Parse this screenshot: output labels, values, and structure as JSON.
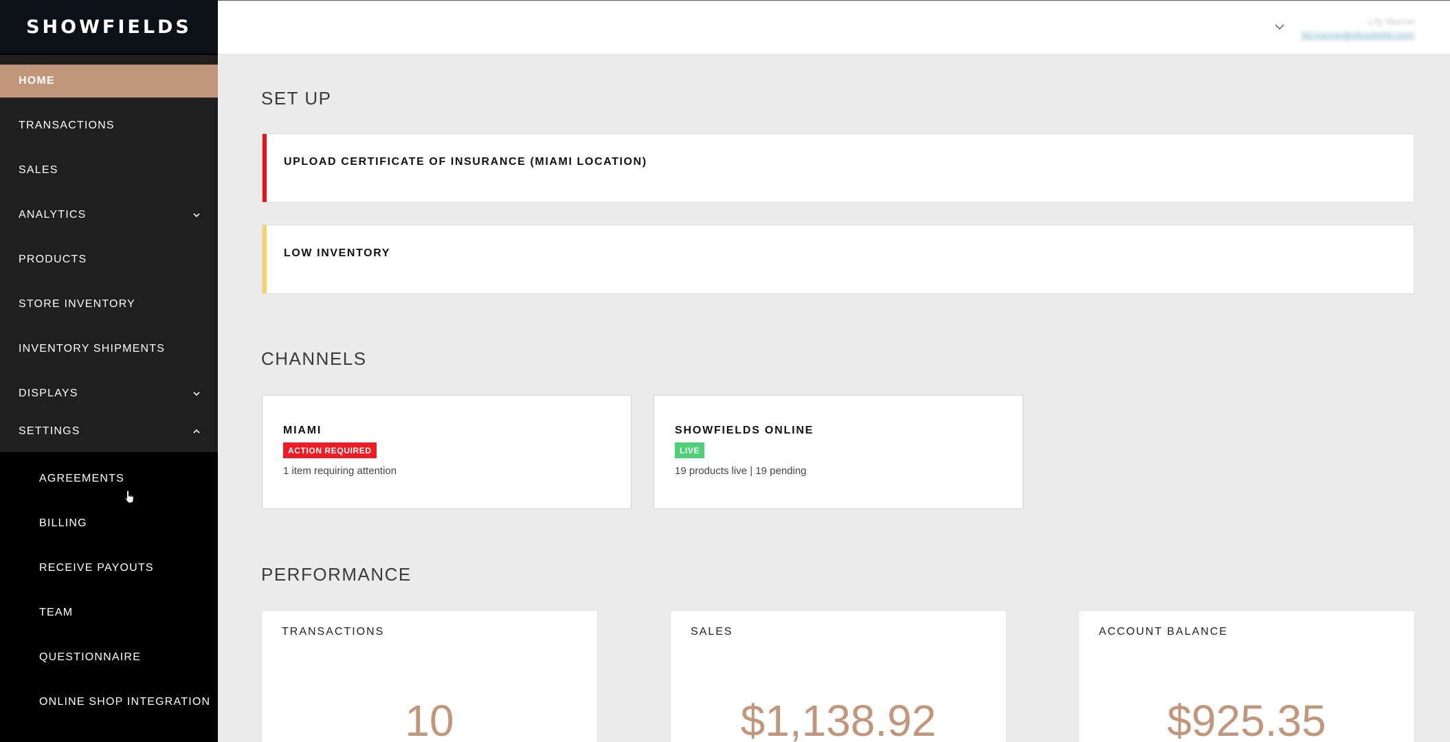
{
  "brand": {
    "logo_text": "SHOWFIELDS",
    "accent_color": "#c2967a"
  },
  "sidebar": {
    "items": [
      {
        "label": "HOME",
        "active": true
      },
      {
        "label": "TRANSACTIONS"
      },
      {
        "label": "SALES"
      },
      {
        "label": "ANALYTICS",
        "expandable": true,
        "expanded": false
      },
      {
        "label": "PRODUCTS"
      },
      {
        "label": "STORE INVENTORY"
      },
      {
        "label": "INVENTORY SHIPMENTS"
      },
      {
        "label": "DISPLAYS",
        "expandable": true,
        "expanded": false
      },
      {
        "label": "SETTINGS",
        "expandable": true,
        "expanded": true
      }
    ],
    "settings_submenu": [
      {
        "label": "AGREEMENTS"
      },
      {
        "label": "BILLING"
      },
      {
        "label": "RECEIVE PAYOUTS"
      },
      {
        "label": "TEAM"
      },
      {
        "label": "QUESTIONNAIRE"
      },
      {
        "label": "ONLINE SHOP INTEGRATION"
      }
    ]
  },
  "topbar": {
    "user_name": "Lily Mercer",
    "user_email": "lily.mercer@showfields.com",
    "menu_icon": "chevron-down-icon"
  },
  "setup": {
    "title": "SET UP",
    "tasks": [
      {
        "label": "UPLOAD CERTIFICATE OF INSURANCE (MIAMI LOCATION)",
        "status_color": "#e8141b"
      },
      {
        "label": "LOW INVENTORY",
        "status_color": "#f6d368"
      }
    ]
  },
  "channels": {
    "title": "CHANNELS",
    "cards": [
      {
        "name": "MIAMI",
        "badge": "ACTION REQUIRED",
        "badge_color": "#ee1c25",
        "description": "1 item requiring attention"
      },
      {
        "name": "SHOWFIELDS ONLINE",
        "badge": "LIVE",
        "badge_color": "#4cd176",
        "description": "19 products live | 19 pending"
      }
    ]
  },
  "performance": {
    "title": "PERFORMANCE",
    "cards": [
      {
        "title": "TRANSACTIONS",
        "value": "10"
      },
      {
        "title": "SALES",
        "value": "$1,138.92"
      },
      {
        "title": "ACCOUNT BALANCE",
        "value": "$925.35"
      }
    ]
  }
}
